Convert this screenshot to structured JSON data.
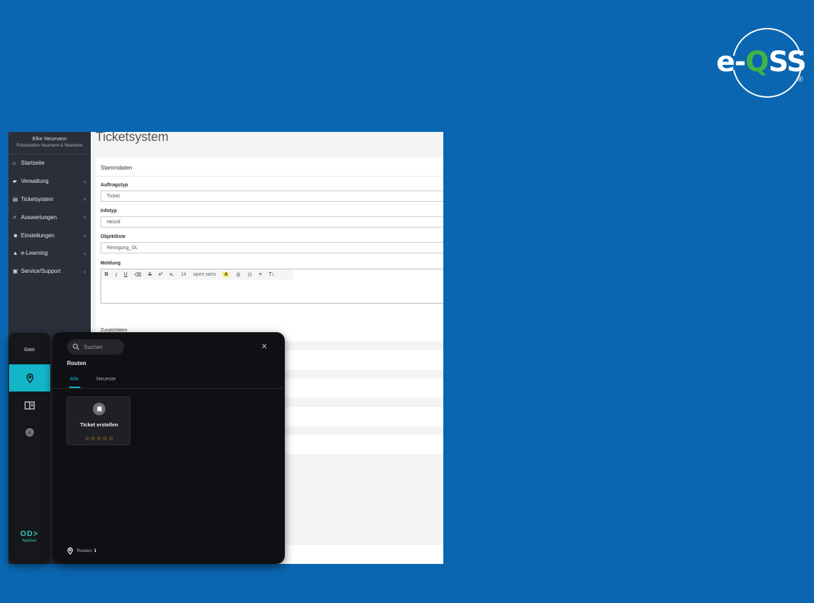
{
  "brand": {
    "prefix": "e-",
    "q": "Q",
    "suffix": "SS",
    "registered": "®"
  },
  "sidebar": {
    "user_name": "Elke Neumann",
    "company": "Präsentation Neumann & Neumann",
    "items": [
      {
        "label": "Startseite",
        "icon": "home-icon",
        "has_submenu": false
      },
      {
        "label": "Verwaltung",
        "icon": "folder-icon",
        "has_submenu": true
      },
      {
        "label": "Ticketsystem",
        "icon": "ticket-icon",
        "has_submenu": true
      },
      {
        "label": "Auswertungen",
        "icon": "chart-icon",
        "has_submenu": true
      },
      {
        "label": "Einstellungen",
        "icon": "user-gear-icon",
        "has_submenu": true
      },
      {
        "label": "e-Learning",
        "icon": "graduation-cap-icon",
        "has_submenu": true
      },
      {
        "label": "Service/Support",
        "icon": "book-icon",
        "has_submenu": true
      }
    ]
  },
  "page": {
    "title": "Ticketsystem",
    "section": "Stammdaten",
    "fields": {
      "auftragstyp": {
        "label": "Auftragstyp",
        "value": "Ticket"
      },
      "infotyp": {
        "label": "Infotyp",
        "value": "Heizöl"
      },
      "objektliste": {
        "label": "Objektliste",
        "value": "Reinigung_OL"
      },
      "meldung": {
        "label": "Meldung"
      }
    },
    "toolbar": {
      "bold": "B",
      "italic": "I",
      "underline": "U",
      "eraser": "⌫",
      "strike": "S",
      "superscript": "x²",
      "subscript": "x₂",
      "font_size": "14",
      "font_name": "open sans",
      "highlight": "A",
      "ul": "☰",
      "ol": "☷",
      "align": "≡",
      "text_size": "T↕"
    },
    "section2": "Zusatzdaten"
  },
  "appnavi": {
    "user": "Gast",
    "search_placeholder": "Suchen",
    "heading": "Routen",
    "tabs": [
      "Alle",
      "Neueste"
    ],
    "active_tab": "Alle",
    "cards": [
      {
        "title": "Ticket erstellen",
        "stars": "☆☆☆☆☆",
        "rating": 0,
        "max_rating": 5
      }
    ],
    "footer_label": "Routen:",
    "footer_count": "1",
    "logo_mark": "OD>",
    "logo_text": "AppNavi"
  },
  "colors": {
    "background": "#0a66b0",
    "accent": "#13b5c8",
    "logo_q": "#3fb24a",
    "star": "#f2a51a"
  }
}
